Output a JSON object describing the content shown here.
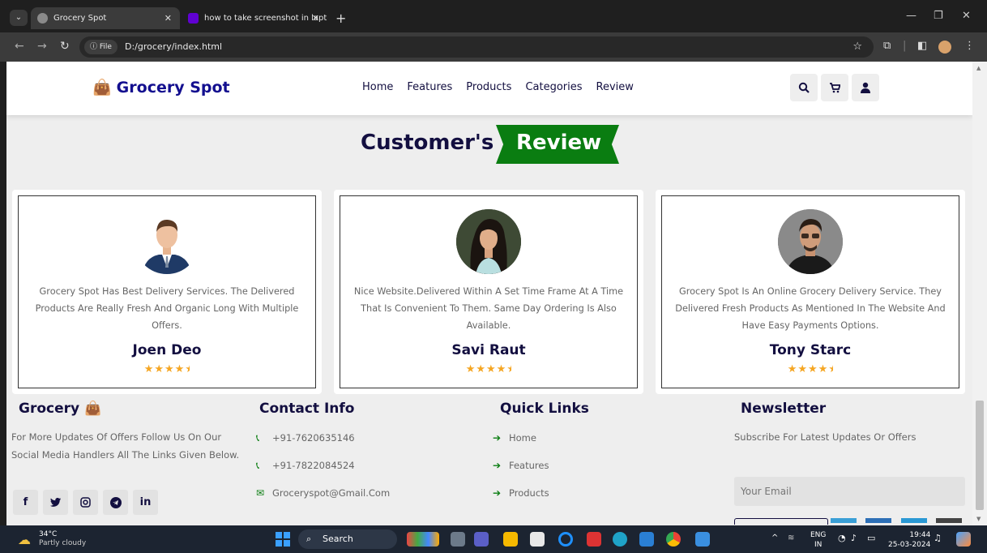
{
  "browser": {
    "tabs": [
      {
        "title": "Grocery Spot",
        "active": true
      },
      {
        "title": "how to take screenshot in lapto",
        "active": false
      }
    ],
    "url_chip": "File",
    "url": "D:/grocery/index.html"
  },
  "header": {
    "logo": "Grocery Spot",
    "nav": [
      "Home",
      "Features",
      "Products",
      "Categories",
      "Review"
    ]
  },
  "section": {
    "heading_dark": "Customer's",
    "heading_accent": "Review"
  },
  "reviews": [
    {
      "text": "Grocery Spot Has Best Delivery Services. The Delivered Products Are Really Fresh And Organic Long With Multiple Offers.",
      "name": "Joen Deo",
      "rating": 4.5
    },
    {
      "text": "Nice Website.Delivered Within A Set Time Frame At A Time That Is Convenient To Them. Same Day Ordering Is Also Available.",
      "name": "Savi Raut",
      "rating": 4.5
    },
    {
      "text": "Grocery Spot Is An Online Grocery Delivery Service. They Delivered Fresh Products As Mentioned In The Website And Have Easy Payments Options.",
      "name": "Tony Starc",
      "rating": 4.5
    }
  ],
  "footer": {
    "brand": {
      "title": "Grocery",
      "text": "For More Updates Of Offers Follow Us On Our Social Media Handlers All The Links Given Below."
    },
    "contact": {
      "title": "Contact Info",
      "items": [
        "+91-7620635146",
        "+91-7822084524",
        "Groceryspot@Gmail.Com"
      ]
    },
    "links": {
      "title": "Quick Links",
      "items": [
        "Home",
        "Features",
        "Products"
      ]
    },
    "newsletter": {
      "title": "Newsletter",
      "text": "Subscribe For Latest Updates Or Offers",
      "placeholder": "Your Email"
    }
  },
  "taskbar": {
    "weather_temp": "34°C",
    "weather_desc": "Partly cloudy",
    "search": "Search",
    "lang": "ENG",
    "region": "IN",
    "time": "19:44",
    "date": "25-03-2024"
  },
  "colors": {
    "brand_navy": "#130f40",
    "accent_green": "#0a7d11",
    "star": "#f5a623"
  }
}
